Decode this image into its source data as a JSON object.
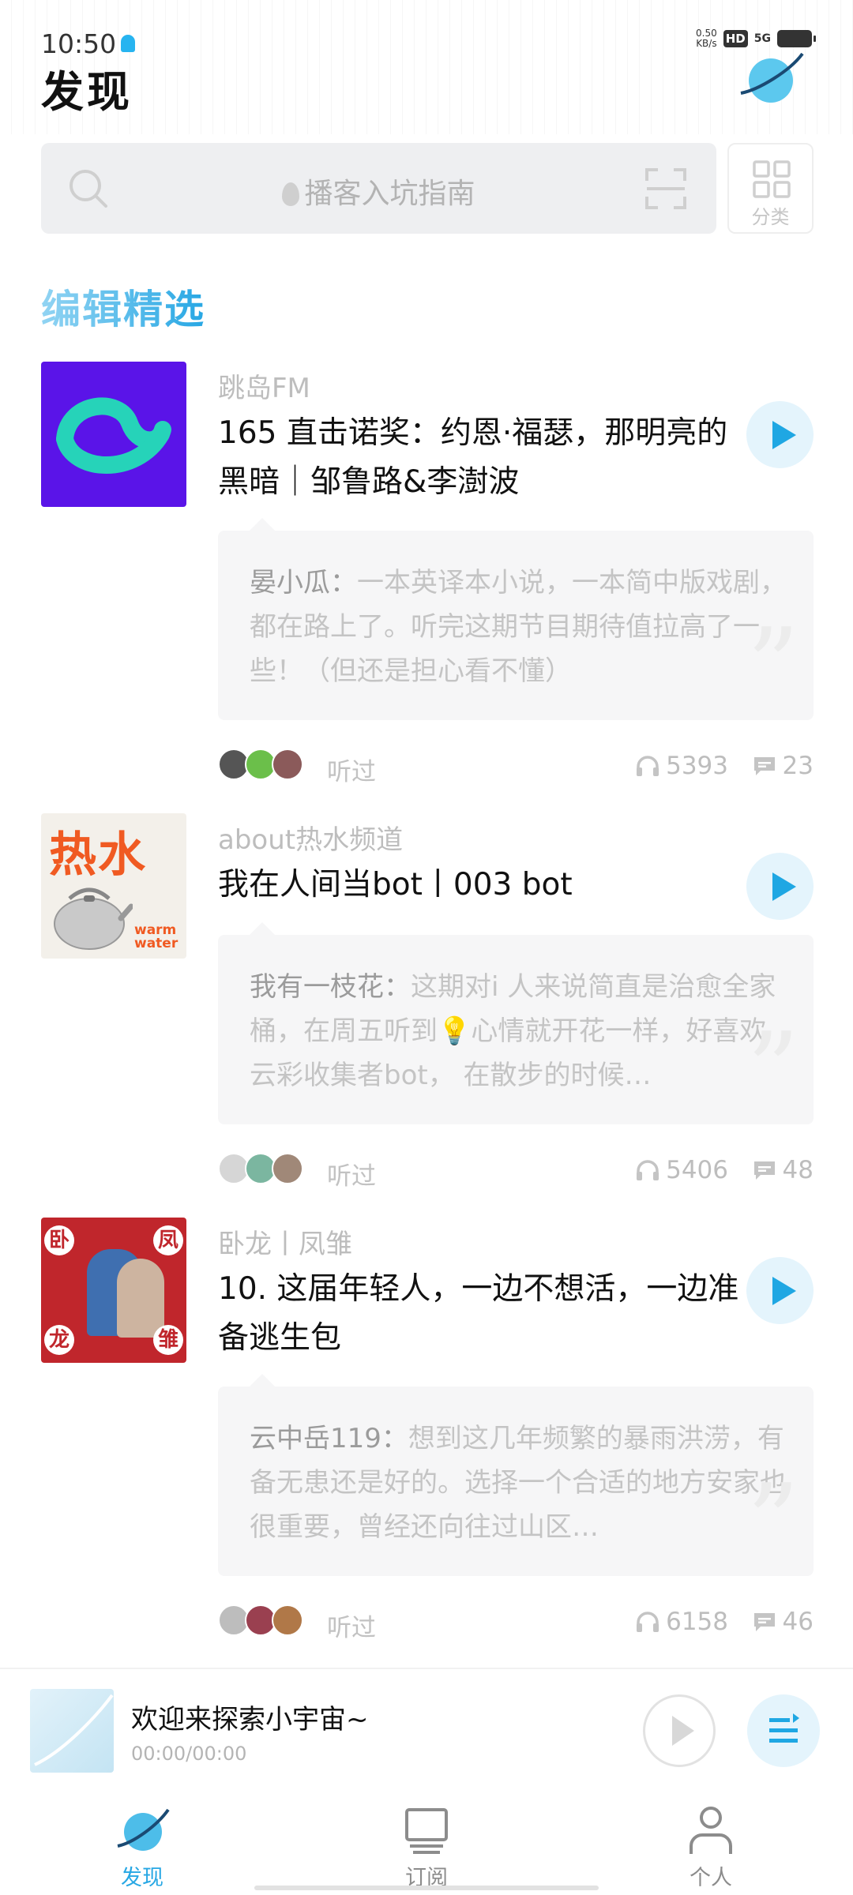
{
  "status_bar": {
    "time": "10:50",
    "net_speed_value": "0.50",
    "net_speed_unit": "KB/s",
    "hd": "HD",
    "network": "5G"
  },
  "header": {
    "title": "发现"
  },
  "search": {
    "placeholder": "播客入坑指南",
    "category_label": "分类"
  },
  "section": {
    "title": "编辑精选"
  },
  "episodes": [
    {
      "podcast": "跳岛FM",
      "title": "165 直击诺奖：约恩·福瑟，那明亮的黑暗｜邹鲁路&李澍波",
      "comment_user": "晏小瓜：",
      "comment_text": "一本英译本小说，一本简中版戏剧，都在路上了。听完这期节目期待值拉高了一些！（但还是担心看不懂）",
      "heard_label": "听过",
      "plays": "5393",
      "comments": "23"
    },
    {
      "podcast": "about热水频道",
      "title": "我在人间当bot丨003 bot",
      "comment_user": "我有一枝花：",
      "comment_text": "这期对i 人来说简直是治愈全家桶，在周五听到💡心情就开花一样，好喜欢云彩收集者bot， 在散步的时候…",
      "heard_label": "听过",
      "plays": "5406",
      "comments": "48",
      "cover_text": "热水",
      "cover_subtext": "warm water"
    },
    {
      "podcast": "卧龙丨凤雏",
      "title": "10. 这届年轻人，一边不想活，一边准备逃生包",
      "comment_user": "云中岳119：",
      "comment_text": "想到这几年频繁的暴雨洪涝，有备无患还是好的。选择一个合适的地方安家也很重要，曾经还向往过山区…",
      "heard_label": "听过",
      "plays": "6158",
      "comments": "46",
      "cover_chars": [
        "卧",
        "凤",
        "龙",
        "雏"
      ]
    }
  ],
  "mini_player": {
    "title": "欢迎来探索小宇宙~",
    "time": "00:00/00:00"
  },
  "bottom_nav": {
    "items": [
      {
        "label": "发现",
        "icon": "planet-icon",
        "active": true
      },
      {
        "label": "订阅",
        "icon": "monitor-icon",
        "active": false
      },
      {
        "label": "个人",
        "icon": "person-icon",
        "active": false
      }
    ]
  },
  "colors": {
    "accent": "#27a7e4",
    "accent_light": "#e4f4fc",
    "card_bg": "#f6f6f7",
    "cover1_bg": "#5a14e8",
    "cover1_mark": "#26d3b9",
    "cover2_text": "#f05a22",
    "cover3_bg": "#c0262c"
  }
}
